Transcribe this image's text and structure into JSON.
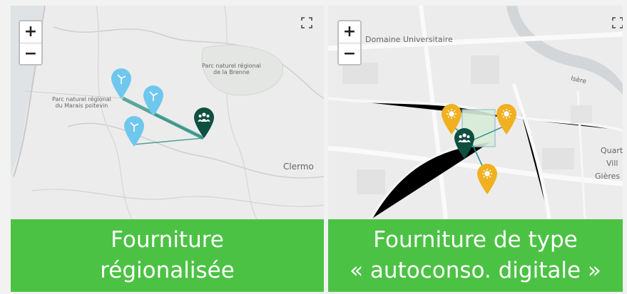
{
  "left_panel": {
    "caption_line1": "Fourniture",
    "caption_line2": "régionalisée",
    "zoom_in": "+",
    "zoom_out": "−",
    "map_labels": {
      "park_brenne_line1": "Parc naturel régional",
      "park_brenne_line2": "de la Brenne",
      "park_marais_line1": "Parc naturel régional",
      "park_marais_line2": "du Marais poitevin",
      "clermont": "Clermo"
    },
    "pin_colors": {
      "supplier": "#6fc7ee",
      "consumer": "#0f4f3f"
    },
    "pin_icons": {
      "supplier": "wind-turbine-icon",
      "consumer": "people-group-icon"
    }
  },
  "right_panel": {
    "caption_line1": "Fourniture de type",
    "caption_line2": "« autoconso. digitale »",
    "zoom_in": "+",
    "zoom_out": "−",
    "map_labels": {
      "campus": "Domaine Universitaire",
      "river": "Isère",
      "quart": "Quart",
      "vill": "Vill",
      "gieres": "Gières"
    },
    "pin_colors": {
      "supplier": "#f0b020",
      "consumer": "#0f4f3f"
    },
    "pin_icons": {
      "supplier": "sun-icon",
      "consumer": "people-group-icon"
    }
  },
  "accent_green": "#4cc245"
}
